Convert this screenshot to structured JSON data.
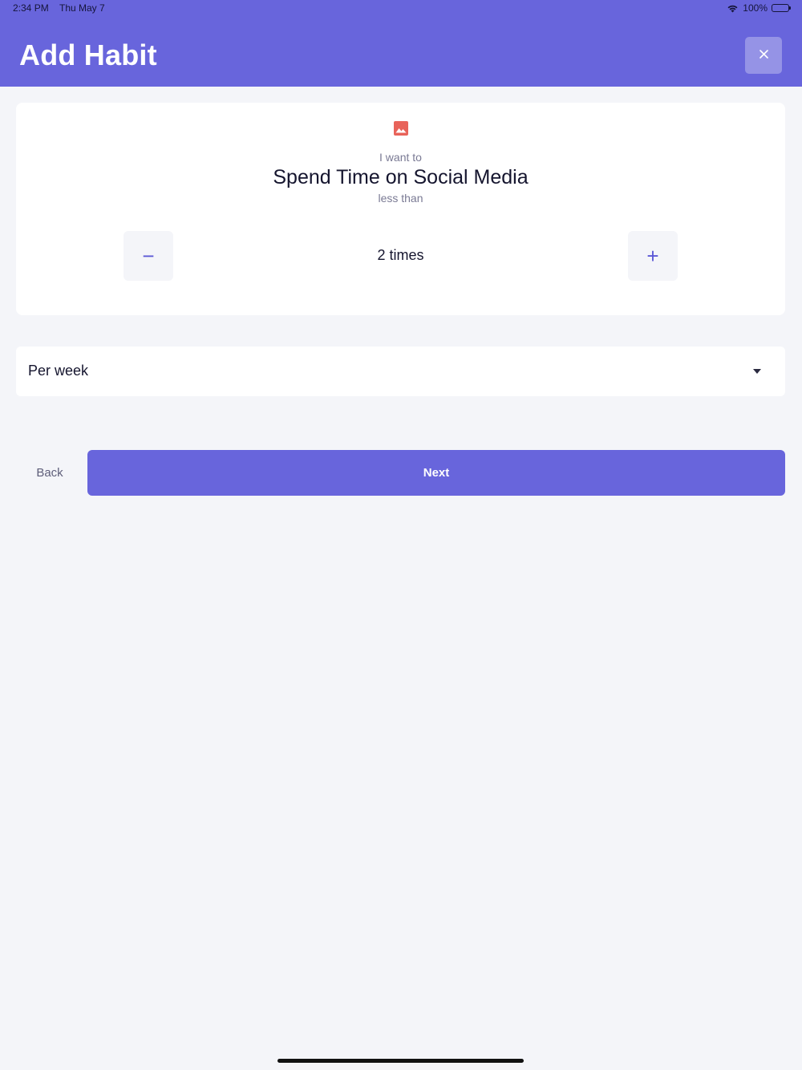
{
  "status_bar": {
    "time": "2:34 PM",
    "date": "Thu May 7",
    "battery": "100%"
  },
  "header": {
    "title": "Add Habit",
    "close_icon": "close-icon",
    "close_label": "×"
  },
  "habit_card": {
    "icon": "image-icon",
    "icon_color": "#e8635a",
    "intro": "I want to",
    "habit_name": "Spend Time on Social Media",
    "qualifier": "less than",
    "decrement_label": "−",
    "increment_label": "+",
    "count_text": "2 times"
  },
  "frequency": {
    "selected": "Per week",
    "arrow_icon": "caret-down-icon"
  },
  "actions": {
    "back_label": "Back",
    "next_label": "Next"
  },
  "colors": {
    "accent": "#6865dc",
    "background": "#f4f5f9"
  }
}
